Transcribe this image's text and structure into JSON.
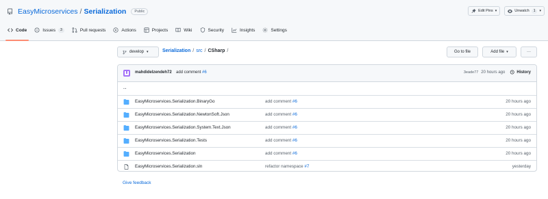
{
  "repo": {
    "owner": "EasyMicroservices",
    "separator": "/",
    "name": "Serialization",
    "visibility": "Public",
    "actions": [
      {
        "icon": "pin-icon",
        "label": "Edit Pins",
        "has_caret": true,
        "count": ""
      },
      {
        "icon": "eye-icon",
        "label": "Unwatch",
        "has_caret": true,
        "count": "1"
      }
    ]
  },
  "nav": {
    "tabs": [
      {
        "icon": "code-icon",
        "label": "Code",
        "count": "",
        "selected": true
      },
      {
        "icon": "issue-icon",
        "label": "Issues",
        "count": "3",
        "selected": false
      },
      {
        "icon": "pull-request-icon",
        "label": "Pull requests",
        "count": "",
        "selected": false
      },
      {
        "icon": "play-icon",
        "label": "Actions",
        "count": "",
        "selected": false
      },
      {
        "icon": "project-table-icon",
        "label": "Projects",
        "count": "",
        "selected": false
      },
      {
        "icon": "book-icon",
        "label": "Wiki",
        "count": "",
        "selected": false
      },
      {
        "icon": "shield-icon",
        "label": "Security",
        "count": "",
        "selected": false
      },
      {
        "icon": "graph-icon",
        "label": "Insights",
        "count": "",
        "selected": false
      },
      {
        "icon": "gear-icon",
        "label": "Settings",
        "count": "",
        "selected": false
      }
    ]
  },
  "file_nav": {
    "branch": "develop",
    "breadcrumb": {
      "root": "Serialization",
      "parts": [
        "src"
      ],
      "current": "CSharp",
      "sep": "/"
    },
    "go_to_file": "Go to file",
    "add_file": "Add file",
    "more": "···"
  },
  "latest_commit": {
    "author": "mahdidelzendeh72",
    "message": "add comment",
    "issue": "#6",
    "sha": "3eade77",
    "time": "20 hours ago",
    "history_label": "History"
  },
  "up_link": "..",
  "files": [
    {
      "type": "dir",
      "icon": "folder-icon",
      "name": "EasyMicroservices.Serialization.BinaryGo",
      "message": "add comment",
      "issue": "#6",
      "age": "20 hours ago"
    },
    {
      "type": "dir",
      "icon": "folder-icon",
      "name": "EasyMicroservices.Serialization.NewtonSoft.Json",
      "message": "add comment",
      "issue": "#6",
      "age": "20 hours ago"
    },
    {
      "type": "dir",
      "icon": "folder-icon",
      "name": "EasyMicroservices.Serialization.System.Text.Json",
      "message": "add comment",
      "issue": "#6",
      "age": "20 hours ago"
    },
    {
      "type": "dir",
      "icon": "folder-icon",
      "name": "EasyMicroservices.Serialization.Tests",
      "message": "add comment",
      "issue": "#6",
      "age": "20 hours ago"
    },
    {
      "type": "dir",
      "icon": "folder-icon",
      "name": "EasyMicroservices.Serialization",
      "message": "add comment",
      "issue": "#6",
      "age": "20 hours ago"
    },
    {
      "type": "file",
      "icon": "file-icon",
      "name": "EasyMicroservices.Serialization.sln",
      "message": "refactor namespace",
      "issue": "#7",
      "age": "yesterday"
    }
  ],
  "feedback_link": "Give feedback",
  "colors": {
    "link": "#0969da",
    "folder": "#54aeff",
    "selected_tab_underline": "#fd8c73",
    "avatar": "#a371f7"
  }
}
